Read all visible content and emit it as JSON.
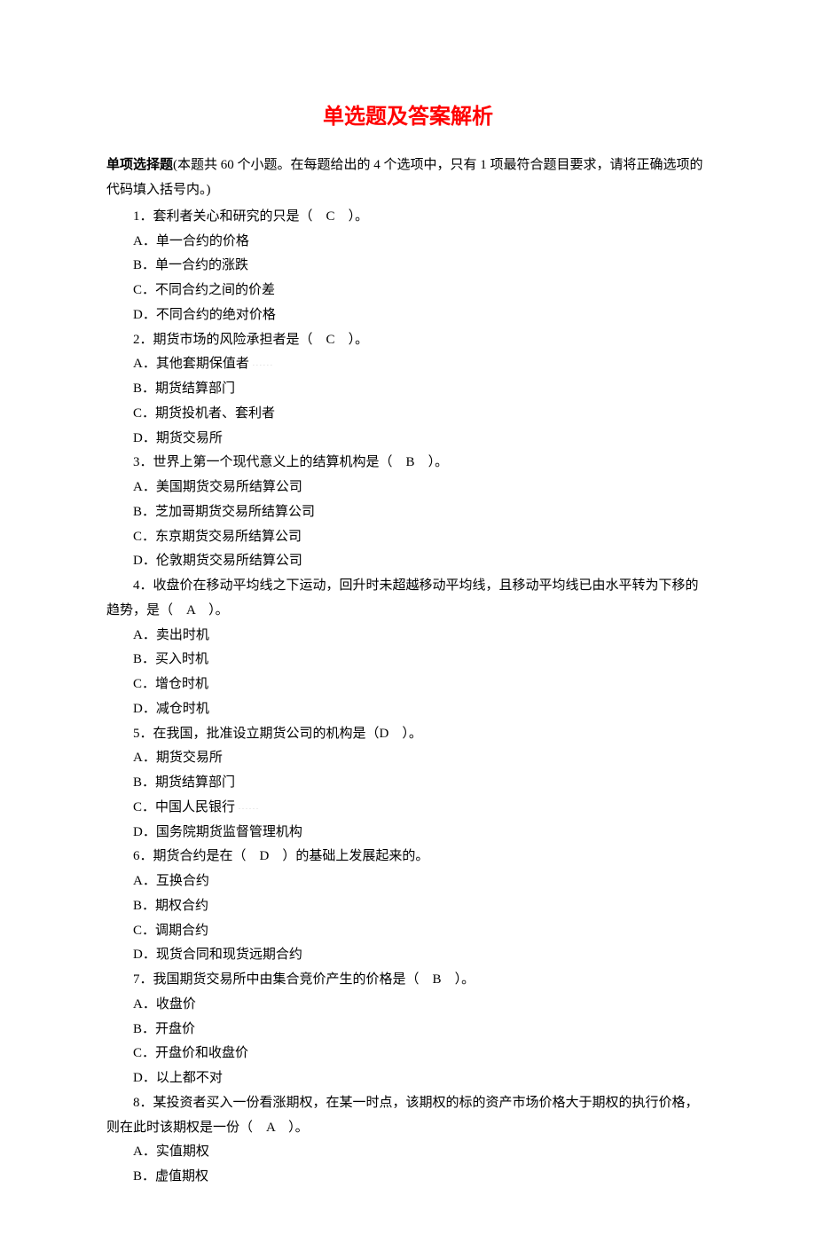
{
  "title": "单选题及答案解析",
  "instructions": {
    "bold": "单项选择题",
    "text": "(本题共 60 个小题。在每题给出的 4 个选项中，只有 1 项最符合题目要求，请将正确选项的代码填入括号内。)"
  },
  "questions": [
    {
      "num": "1",
      "stem_pre": "．套利者关心和研究的只是（",
      "answer": "C",
      "stem_post": "）。",
      "opts": {
        "A": "A．单一合约的价格",
        "B": "B．单一合约的涨跌",
        "C": "C．不同合约之间的价差",
        "D": "D．不同合约的绝对价格"
      }
    },
    {
      "num": "2",
      "stem_pre": "．期货市场的风险承担者是（",
      "answer": "C",
      "stem_post": "）。",
      "opts": {
        "A": "A．其他套期保值者",
        "B": "B．期货结算部门",
        "C": "C．期货投机者、套利者",
        "D": "D．期货交易所"
      },
      "faint_after_A": true
    },
    {
      "num": "3",
      "stem_pre": "．世界上第一个现代意义上的结算机构是（",
      "answer": "B",
      "stem_post": "）。",
      "opts": {
        "A": "A．美国期货交易所结算公司",
        "B": "B．芝加哥期货交易所结算公司",
        "C": "C．东京期货交易所结算公司",
        "D": "D．伦敦期货交易所结算公司"
      }
    },
    {
      "num": "4",
      "stem_pre": "．收盘价在移动平均线之下运动，回升时未超越移动平均线，且移动平均线已由水平转为下移的趋势，是（",
      "answer": "A",
      "stem_post": "）。",
      "wrap": true,
      "opts": {
        "A": "A．卖出时机",
        "B": "B．买入时机",
        "C": "C．增仓时机",
        "D": "D．减仓时机"
      }
    },
    {
      "num": "5",
      "stem_pre": "．在我国，批准设立期货公司的机构是（",
      "answer": "D",
      "stem_post": "）。",
      "no_space_before_answer": true,
      "opts": {
        "A": "A．期货交易所",
        "B": "B．期货结算部门",
        "C": "C．中国人民银行",
        "D": "D．国务院期货监督管理机构"
      },
      "faint_after_C": true
    },
    {
      "num": "6",
      "stem_pre": "．期货合约是在（",
      "answer": "D",
      "stem_post": "）的基础上发展起来的。",
      "opts": {
        "A": "A．互换合约",
        "B": "B．期权合约",
        "C": "C．调期合约",
        "D": "D．现货合同和现货远期合约"
      }
    },
    {
      "num": "7",
      "stem_pre": "．我国期货交易所中由集合竞价产生的价格是（",
      "answer": "B",
      "stem_post": "）。",
      "opts": {
        "A": "A．收盘价",
        "B": "B．开盘价",
        "C": "C．开盘价和收盘价",
        "D": "D．以上都不对"
      }
    },
    {
      "num": "8",
      "stem_pre": "．某投资者买入一份看涨期权，在某一时点，该期权的标的资产市场价格大于期权的执行价格，则在此时该期权是一份（",
      "answer": "A",
      "stem_post": "）。",
      "wrap": true,
      "opts": {
        "A": "A．实值期权",
        "B": "B．虚值期权"
      }
    }
  ]
}
